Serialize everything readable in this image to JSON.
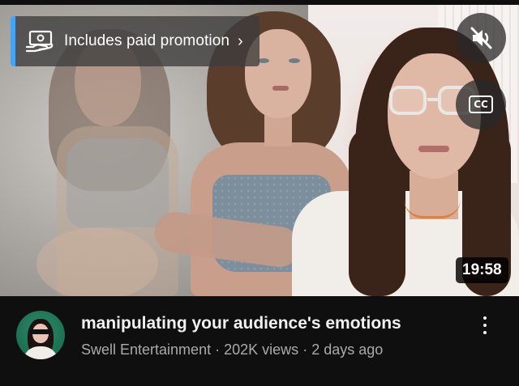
{
  "video": {
    "promo_label": "Includes paid promotion",
    "duration": "19:58",
    "title": "manipulating your audience's emotions",
    "channel": "Swell Entertainment",
    "separator": "·",
    "views": "202K views",
    "age": "2 days ago"
  },
  "controls": {
    "cc_label": "CC",
    "chevron": "›",
    "mute_icon": "volume-muted-icon",
    "captions_icon": "closed-captions-icon",
    "menu_icon": "more-vertical-icon",
    "promo_icon": "paid-promotion-icon"
  },
  "colors": {
    "accent": "#3ea6ff",
    "background": "#0f0f0f",
    "title": "#f1f1f1",
    "subtitle": "#aaaaaa"
  }
}
